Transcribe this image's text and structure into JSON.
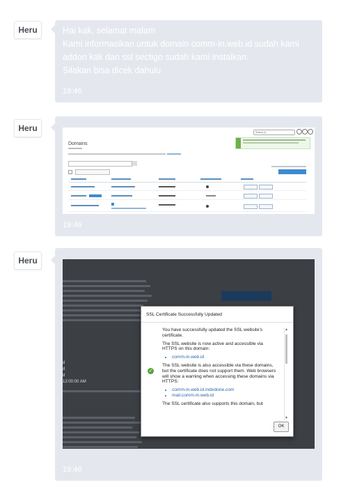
{
  "messages": [
    {
      "sender": "Heru",
      "text": "Hai kak, selamat malam\nKami informasikan untuk domain comm-in.web.id sudah kami addon kak dan ssl sectigo sudah kami instalkan.\nSilakan bisa dicek dahulu",
      "time": "19:46"
    },
    {
      "sender": "Heru",
      "time": "19:46",
      "screenshot": {
        "page_title": "Domains"
      }
    },
    {
      "sender": "Heru",
      "time": "19:46",
      "screenshot": {
        "dialog_title": "SSL Certificate Successfully Updated",
        "intro": "You have successfully updated the SSL website's certificate.",
        "active_text": "The SSL website is now active and accessible via HTTPS on this domain:",
        "active_domains": [
          "comm-in.web.id"
        ],
        "also_text": "The SSL website is also accessible via these domains, but the certificate does not support them. Web browsers will show a warning when accessing these domains via HTTPS:",
        "also_domains": [
          "comm-in.web.id.indodone.com",
          "mail.comm-in.web.id"
        ],
        "cut_text": "The SSL certificate also supports this domain, but",
        "ok_label": "OK",
        "bg_labels": [
          "d",
          "d",
          "d",
          "12:00:00 AM"
        ]
      }
    }
  ]
}
